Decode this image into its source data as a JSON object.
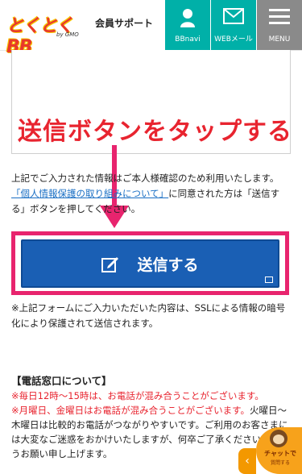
{
  "header": {
    "logo_text": "とくとくBB",
    "logo_sub": "by GMO",
    "site_label": "会員サポート",
    "nav": [
      {
        "label": "BBnavi",
        "icon": "person-icon"
      },
      {
        "label": "WEBメール",
        "icon": "mail-icon"
      },
      {
        "label": "MENU",
        "icon": "hamburger-icon"
      }
    ],
    "colors": {
      "nav_teal": "#00b0a8",
      "nav_gray": "#8a8a8a",
      "logo_red": "#e8382c"
    }
  },
  "annotation": {
    "text": "送信ボタンをタップする",
    "color": "#e8242f"
  },
  "notice": {
    "line1": "上記でご入力された情報はご本人様確認のため利用いたします。",
    "link": "「個人情報保護の取り組みについて」",
    "line2": "に同意された方は「送信する」ボタンを押してください。"
  },
  "submit": {
    "label": "送信する",
    "color": "#1a5fb4"
  },
  "ssl_note": "※上記フォームにご入力いただいた内容は、SSLによる情報の暗号化により保護されて送信されます。",
  "contact": {
    "title": "【電話窓口について】",
    "red_line1": "※毎日12時～15時は、お電話が混み合うことがございます。",
    "red_line2": "※月曜日、金曜日はお電話が混み合うことがございます。",
    "black_tail": "火曜日～木曜日は比較的お電話がつながりやすいです。ご利用のお客さまには大変なご迷惑をおかけいたしますが、何卒ご了承くださいますようお願い申し上げます。"
  },
  "chat": {
    "label": "チャットで",
    "sub": "質問する",
    "tab_icon": "chevron-left-icon"
  }
}
